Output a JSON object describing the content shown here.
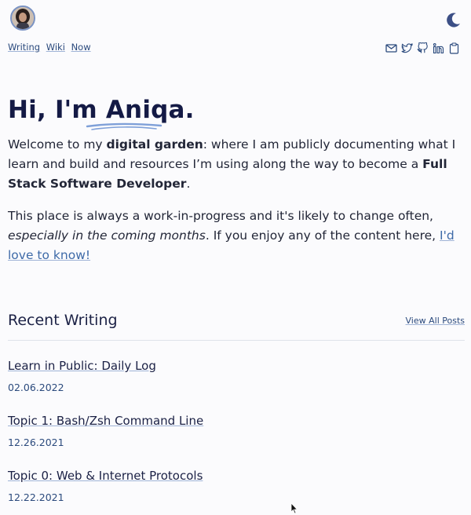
{
  "nav": {
    "links": [
      "Writing",
      "Wiki",
      "Now"
    ]
  },
  "social": {
    "icons": [
      "mail-icon",
      "twitter-icon",
      "github-icon",
      "linkedin-icon",
      "clipboard-icon"
    ]
  },
  "theme_toggle": {
    "icon": "moon-icon"
  },
  "hero": {
    "greeting": "Hi, I'm Aniqa.",
    "p1": {
      "t1": "Welcome to my ",
      "b1": "digital garden",
      "t2": ": where I am publicly documenting what I learn and build and resources I’m using along the way to become a ",
      "b2": "Full Stack Software Developer",
      "t3": "."
    },
    "p2": {
      "t1": "This place is always a work-in-progress and it's likely to change often, ",
      "i1": "especially in the coming months",
      "t2": ". If you enjoy any of the content here, ",
      "link": "I'd love to know!"
    }
  },
  "recent": {
    "heading": "Recent Writing",
    "view_all": "View All Posts",
    "posts": [
      {
        "title": "Learn in Public: Daily Log",
        "date": "02.06.2022"
      },
      {
        "title": "Topic 1: Bash/Zsh Command Line",
        "date": "12.26.2021"
      },
      {
        "title": "Topic 0: Web & Internet Protocols",
        "date": "12.22.2021"
      }
    ]
  },
  "colors": {
    "accent": "#2b4a7d",
    "heading": "#141a45",
    "underline": "#7fa0d8",
    "background": "#fbfbfd"
  }
}
